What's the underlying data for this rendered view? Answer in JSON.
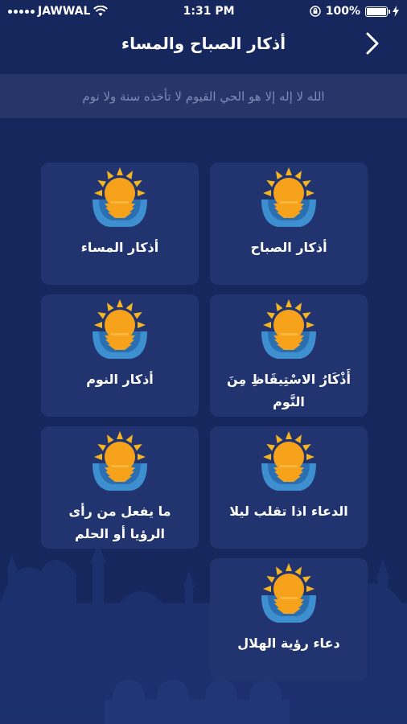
{
  "status_bar": {
    "carrier": "JAWWAL",
    "time": "1:31 PM",
    "battery": "100%"
  },
  "header": {
    "title": "أذكار الصباح والمساء"
  },
  "banner": {
    "verse": "الله لا إله إلا هو الحي القيوم لا تأخذه سنة ولا نوم"
  },
  "cards": [
    {
      "label": "أذكار الصباح",
      "icon": "sunrise-icon"
    },
    {
      "label": "أذكار المساء",
      "icon": "sunrise-icon"
    },
    {
      "label": "أَذْكَارُ الاسْتِيقَاظِ مِنَ النَّوم",
      "icon": "sunrise-icon"
    },
    {
      "label": "أذكار النوم",
      "icon": "sunrise-icon"
    },
    {
      "label": "الدعاء اذا تقلب ليلا",
      "icon": "sunrise-icon"
    },
    {
      "label": "ما يفعل من رأى الرؤيا أو الحلم",
      "icon": "sunrise-icon"
    },
    {
      "label": "دعاء رؤية الهلال",
      "icon": "sunrise-icon"
    }
  ],
  "colors": {
    "background": "#16275e",
    "card": "#213470",
    "sun": "#f7a21b",
    "water": "#3e8fcf"
  }
}
